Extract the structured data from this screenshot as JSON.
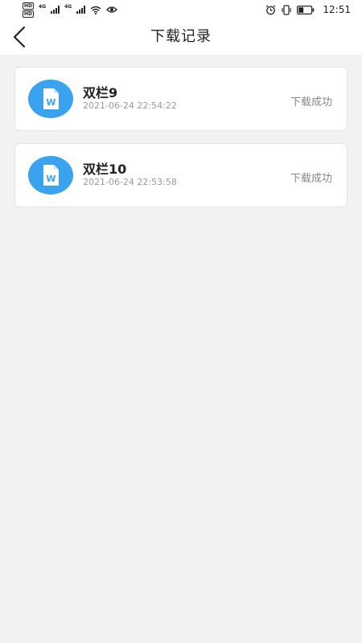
{
  "status_bar": {
    "hd1": "HD",
    "hd2": "HD",
    "net1": "4G",
    "net2": "4G",
    "time": "12:51"
  },
  "header": {
    "title": "下载记录"
  },
  "records": [
    {
      "name": "双栏9",
      "date": "2021-06-24 22:54:22",
      "status": "下载成功",
      "icon_letter": "W"
    },
    {
      "name": "双栏10",
      "date": "2021-06-24 22:53:58",
      "status": "下载成功",
      "icon_letter": "W"
    }
  ],
  "colors": {
    "icon_bg": "#3aa3f0",
    "background": "#f2f2f2"
  }
}
